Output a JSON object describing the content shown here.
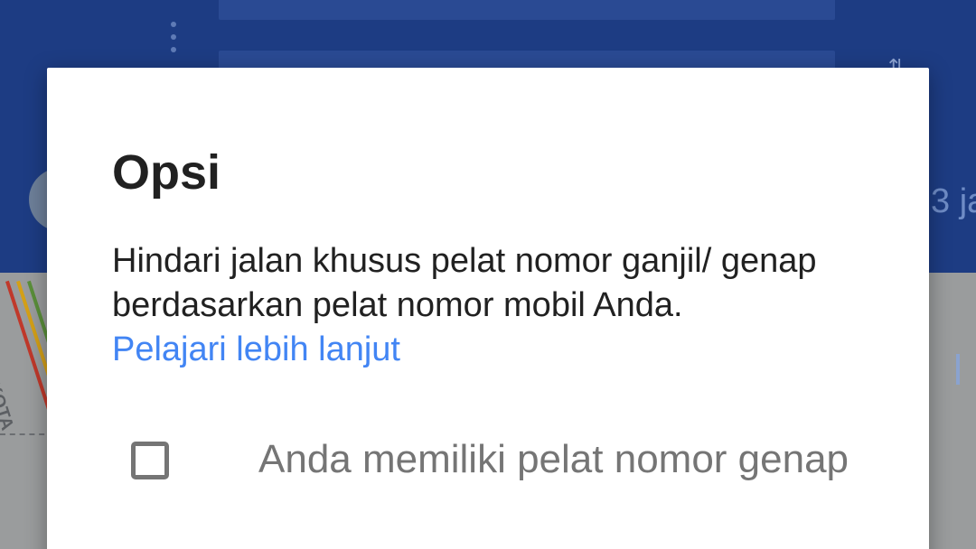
{
  "background": {
    "eta_text": "3 ja",
    "street_label": "KOTA"
  },
  "dialog": {
    "title": "Opsi",
    "description": "Hindari jalan khusus pelat nomor ganjil/ genap berdasarkan pelat nomor mobil Anda.",
    "learn_more_label": "Pelajari lebih lanjut",
    "option": {
      "label": "Anda memiliki pelat nomor genap",
      "checked": false
    }
  },
  "colors": {
    "header_blue": "#1d3c83",
    "link_blue": "#4285f4",
    "text_primary": "#212121",
    "text_secondary": "#757575"
  }
}
